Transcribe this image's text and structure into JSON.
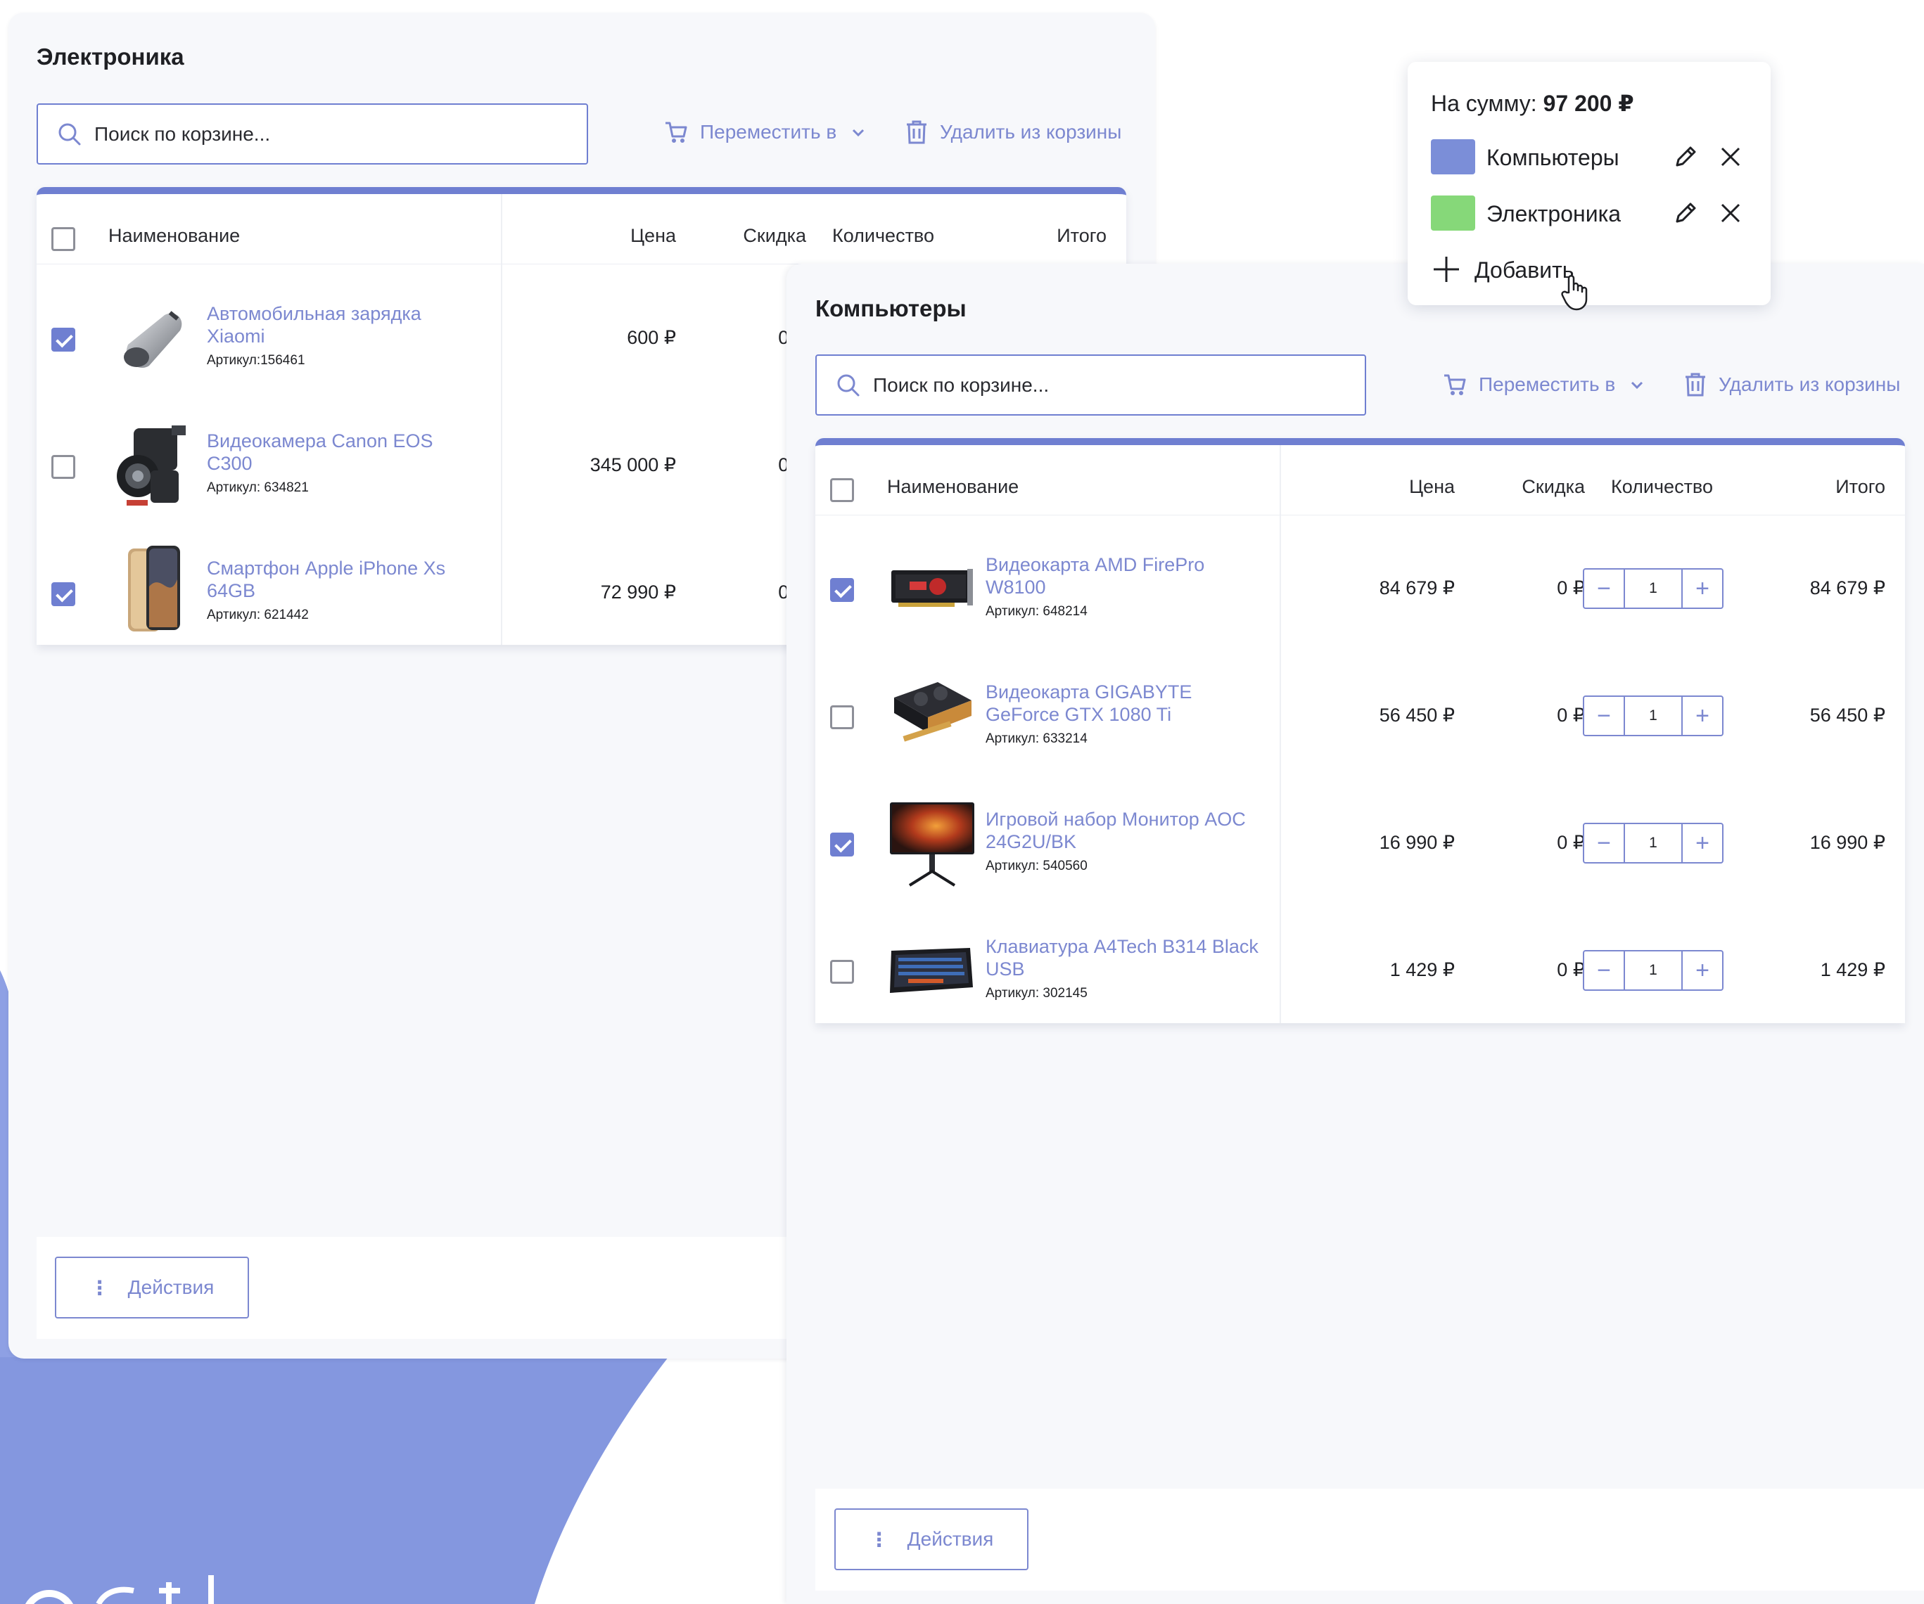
{
  "colors": {
    "accent": "#6f7fd1",
    "link": "#7c88d0",
    "computers_swatch": "#7b8ed8",
    "electronics_swatch": "#86d879",
    "background_blob": "#8497df"
  },
  "electronics": {
    "title": "Электроника",
    "search_placeholder": "Поиск по корзине...",
    "move_label": "Переместить в",
    "delete_label": "Удалить из корзины",
    "columns": {
      "name": "Наименование",
      "price": "Цена",
      "discount": "Скидка",
      "quantity": "Количество",
      "total": "Итого"
    },
    "items": [
      {
        "name": "Автомобильная зарядка Xiaomi",
        "sku": "Артикул:156461",
        "price": "600 ₽",
        "discount": "0 ₽",
        "checked": true,
        "icon": "car-charger-image"
      },
      {
        "name": "Видеокамера Canon EOS C300",
        "sku": "Артикул: 634821",
        "price": "345 000 ₽",
        "discount": "0 ₽",
        "checked": false,
        "icon": "video-camera-image"
      },
      {
        "name": "Смартфон Apple iPhone Xs 64GB",
        "sku": "Артикул: 621442",
        "price": "72 990 ₽",
        "discount": "0 ₽",
        "checked": true,
        "icon": "smartphone-image"
      }
    ],
    "actions_label": "Действия"
  },
  "computers": {
    "title": "Компьютеры",
    "search_placeholder": "Поиск по корзине...",
    "move_label": "Переместить в",
    "delete_label": "Удалить из корзины",
    "columns": {
      "name": "Наименование",
      "price": "Цена",
      "discount": "Скидка",
      "quantity": "Количество",
      "total": "Итого"
    },
    "items": [
      {
        "name": "Видеокарта AMD FirePro W8100",
        "sku": "Артикул: 648214",
        "price": "84 679 ₽",
        "discount": "0 ₽",
        "qty": "1",
        "total": "84 679 ₽",
        "checked": true,
        "icon": "graphics-card-image"
      },
      {
        "name": "Видеокарта GIGABYTE GeForce GTX 1080 Ti",
        "sku": "Артикул: 633214",
        "price": "56 450 ₽",
        "discount": "0 ₽",
        "qty": "1",
        "total": "56 450 ₽",
        "checked": false,
        "icon": "graphics-card-image"
      },
      {
        "name": "Игровой набор Монитор AOC 24G2U/BK",
        "sku": "Артикул: 540560",
        "price": "16 990 ₽",
        "discount": "0 ₽",
        "qty": "1",
        "total": "16 990 ₽",
        "checked": true,
        "icon": "monitor-image"
      },
      {
        "name": "Клавиатура A4Tech B314 Black USB",
        "sku": "Артикул: 302145",
        "price": "1 429 ₽",
        "discount": "0 ₽",
        "qty": "1",
        "total": "1 429 ₽",
        "checked": false,
        "icon": "keyboard-image"
      }
    ],
    "actions_label": "Действия"
  },
  "cart_popup": {
    "sum_label": "На сумму:",
    "sum_value": "97 200 ₽",
    "carts": [
      {
        "label": "Компьютеры",
        "color": "#7b8ed8"
      },
      {
        "label": "Электроника",
        "color": "#86d879"
      }
    ],
    "add_label": "Добавить"
  }
}
